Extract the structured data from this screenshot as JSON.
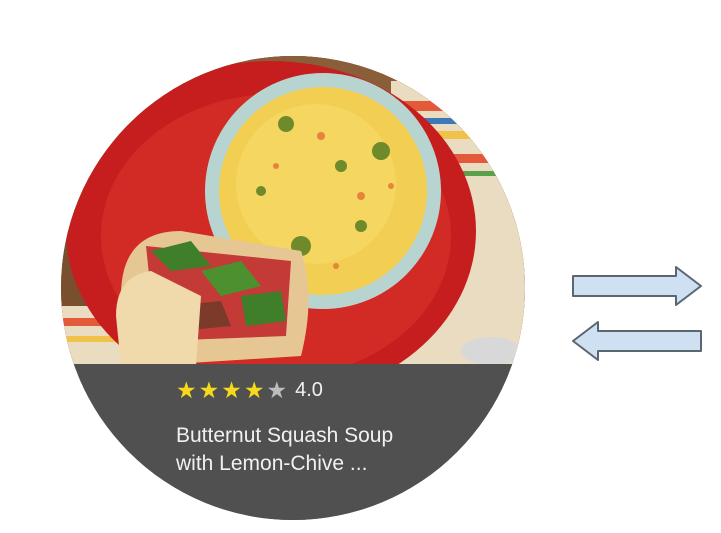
{
  "card": {
    "rating": {
      "stars_filled": 4,
      "stars_total": 5,
      "value": "4.0"
    },
    "title_line1": "Butternut Squash Soup",
    "title_line2": "with Lemon-Chive ..."
  },
  "arrows": {
    "right": "arrow-right-icon",
    "left": "arrow-left-icon"
  },
  "colors": {
    "panel": "#505050",
    "star_filled": "#f7d91c",
    "star_empty": "#bdbdbd",
    "arrow_fill": "#cfe0f3",
    "arrow_stroke": "#5a6670"
  }
}
